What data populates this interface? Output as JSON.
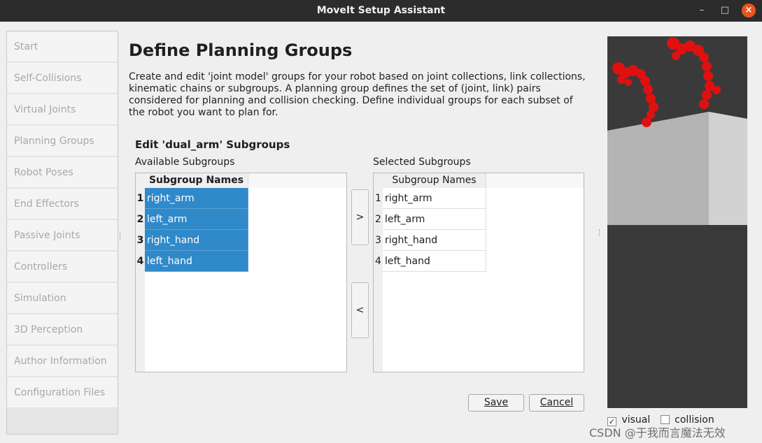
{
  "window": {
    "title": "MoveIt Setup Assistant",
    "minimize_glyph": "–",
    "maximize_glyph": "□",
    "close_glyph": "×"
  },
  "sidebar": {
    "items": [
      {
        "label": "Start"
      },
      {
        "label": "Self-Collisions"
      },
      {
        "label": "Virtual Joints"
      },
      {
        "label": "Planning Groups"
      },
      {
        "label": "Robot Poses"
      },
      {
        "label": "End Effectors"
      },
      {
        "label": "Passive Joints"
      },
      {
        "label": "Controllers"
      },
      {
        "label": "Simulation"
      },
      {
        "label": "3D Perception"
      },
      {
        "label": "Author Information"
      },
      {
        "label": "Configuration Files"
      }
    ]
  },
  "main": {
    "title": "Define Planning Groups",
    "description": "Create and edit 'joint model' groups for your robot based on joint collections, link collections, kinematic chains or subgroups. A planning group defines the set of (joint, link) pairs considered for planning and collision checking. Define individual groups for each subset of the robot you want to plan for.",
    "section_title": "Edit 'dual_arm' Subgroups",
    "available": {
      "label": "Available Subgroups",
      "column_header": "Subgroup Names",
      "rows": [
        {
          "num": "1",
          "name": "right_arm"
        },
        {
          "num": "2",
          "name": "left_arm"
        },
        {
          "num": "3",
          "name": "right_hand"
        },
        {
          "num": "4",
          "name": "left_hand"
        }
      ]
    },
    "selected": {
      "label": "Selected Subgroups",
      "column_header": "Subgroup Names",
      "rows": [
        {
          "num": "1",
          "name": "right_arm"
        },
        {
          "num": "2",
          "name": "left_arm"
        },
        {
          "num": "3",
          "name": "right_hand"
        },
        {
          "num": "4",
          "name": "left_hand"
        }
      ]
    },
    "add_button": ">",
    "remove_button": "<",
    "save_button": "Save",
    "cancel_button": "Cancel"
  },
  "viewport": {
    "visual_label": "visual",
    "visual_checked": true,
    "check_glyph": "✓",
    "collision_label": "collision",
    "collision_checked": false,
    "background_color": "#3a3a3a",
    "robot_color": "#e01010"
  },
  "watermark": "CSDN @于我而言魔法无效",
  "colors": {
    "selection": "#3089c9",
    "titlebar": "#2c2c2c",
    "close_button": "#e9541f"
  }
}
